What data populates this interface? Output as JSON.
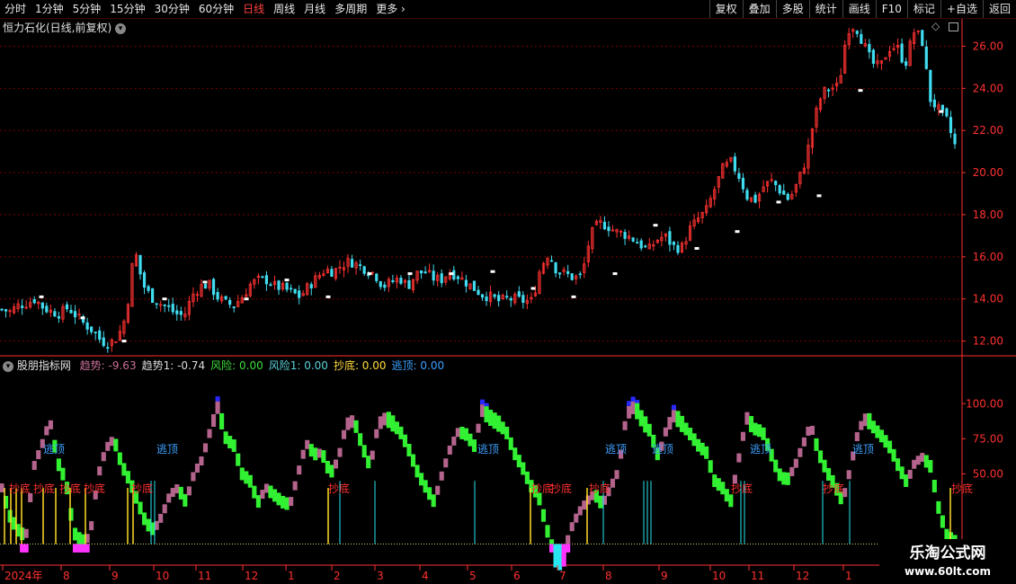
{
  "toolbar": {
    "periods": [
      "分时",
      "1分钟",
      "5分钟",
      "15分钟",
      "30分钟",
      "60分钟",
      "日线",
      "周线",
      "月线",
      "多周期",
      "更多"
    ],
    "active_period": "日线",
    "right_buttons": [
      "复权",
      "叠加",
      "多股",
      "统计",
      "画线",
      "F10",
      "标记",
      "+自选",
      "返回"
    ]
  },
  "stock": {
    "title": "恒力石化(日线,前复权)"
  },
  "indicator": {
    "name": "股朋指标网",
    "items": [
      {
        "label": "趋势: -9.63",
        "color": "#c86e96"
      },
      {
        "label": "趋势1: -0.74",
        "color": "#dcdcdc"
      },
      {
        "label": "风险: 0.00",
        "color": "#3cdc3c"
      },
      {
        "label": "风险1: 0.00",
        "color": "#5ad2dc"
      },
      {
        "label": "抄底: 0.00",
        "color": "#ffdc3c"
      },
      {
        "label": "逃顶: 0.00",
        "color": "#3ca0ff"
      }
    ],
    "signal_labels": {
      "buy": "抄底",
      "sell": "逃顶"
    }
  },
  "colors": {
    "up": "#ff3232",
    "down": "#40dcf0",
    "grid": "#780000",
    "axis": "#ff3030",
    "trend": "#b4648c",
    "risk": "#32f032",
    "magenta": "#ff32ff",
    "cyan": "#28e6f0",
    "blue": "#2828ff",
    "yellow": "#ffdc28"
  },
  "chart_data": [
    {
      "type": "candlestick",
      "title": "恒力石化(日线,前复权)",
      "y_ticks": [
        "26.00",
        "24.00",
        "22.00",
        "20.00",
        "18.00",
        "16.00",
        "14.00",
        "12.00"
      ],
      "ylim": [
        11.3,
        27.3
      ],
      "close_path": [
        13.5,
        13.4,
        13.7,
        13.8,
        14.0,
        13.6,
        13.4,
        13.3,
        13.6,
        13.2,
        12.8,
        12.5,
        12.0,
        11.9,
        12.2,
        13.2,
        16.4,
        14.7,
        14.1,
        13.8,
        13.6,
        13.3,
        13.2,
        14.2,
        14.6,
        14.7,
        14.1,
        13.8,
        13.7,
        14.1,
        14.7,
        14.9,
        14.9,
        14.6,
        14.5,
        14.3,
        14.1,
        14.6,
        15.0,
        15.4,
        15.3,
        15.6,
        15.8,
        15.6,
        15.4,
        15.2,
        14.6,
        14.8,
        15.0,
        14.6,
        15.2,
        15.3,
        15.0,
        14.9,
        15.3,
        15.1,
        14.8,
        14.5,
        14.2,
        14.1,
        13.9,
        14.0,
        14.0,
        13.9,
        13.9,
        15.5,
        16.2,
        15.3,
        15.2,
        15.0,
        15.1,
        17.0,
        17.6,
        17.5,
        17.2,
        17.1,
        16.9,
        16.6,
        16.3,
        16.8,
        17.0,
        16.5,
        16.4,
        17.3,
        17.8,
        18.2,
        19.2,
        20.2,
        20.5,
        19.8,
        18.8,
        18.7,
        19.4,
        19.6,
        19.1,
        18.7,
        19.5,
        20.6,
        22.5,
        23.8,
        24.0,
        24.1,
        26.8,
        27.0,
        26.1,
        25.2,
        25.0,
        25.9,
        26.0,
        25.1,
        26.7,
        26.4,
        23.5,
        23.0,
        22.5,
        21.3
      ]
    },
    {
      "type": "line",
      "title": "股朋指标网",
      "y_ticks": [
        "100.00",
        "75.00",
        "50.00"
      ],
      "ylim": [
        -15,
        120
      ],
      "x_ticks": [
        "2024年",
        "8",
        "9",
        "10",
        "11",
        "12",
        "1",
        "2",
        "3",
        "4",
        "5",
        "6",
        "7",
        "8",
        "9",
        "10",
        "11",
        "12",
        "1"
      ],
      "trend": [
        40,
        20,
        10,
        5,
        55,
        70,
        88,
        58,
        45,
        8,
        2,
        5,
        48,
        68,
        75,
        56,
        45,
        30,
        15,
        10,
        20,
        35,
        40,
        30,
        50,
        60,
        80,
        98,
        75,
        70,
        50,
        45,
        30,
        40,
        35,
        30,
        28,
        50,
        72,
        64,
        65,
        50,
        60,
        85,
        88,
        70,
        55,
        85,
        90,
        85,
        78,
        65,
        50,
        40,
        30,
        50,
        68,
        80,
        78,
        70,
        95,
        90,
        86,
        80,
        65,
        55,
        42,
        35,
        12,
        -8,
        -12,
        10,
        22,
        30,
        36,
        28,
        40,
        52,
        92,
        98,
        88,
        80,
        62,
        82,
        92,
        85,
        78,
        70,
        65,
        45,
        40,
        30,
        60,
        90,
        82,
        80,
        65,
        50,
        45,
        55,
        70,
        85,
        65,
        52,
        42,
        30,
        55,
        82,
        90,
        82,
        76,
        68,
        55,
        44,
        58,
        62,
        55,
        25,
        6,
        2
      ]
    }
  ]
}
